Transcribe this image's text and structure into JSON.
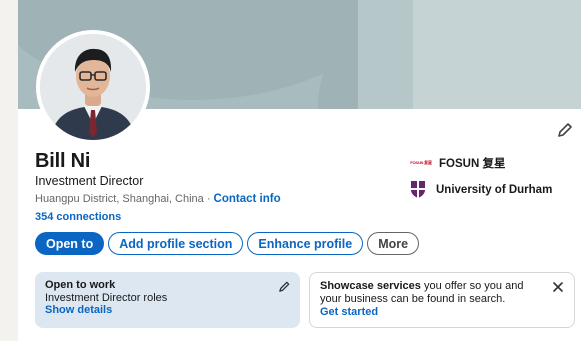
{
  "profile": {
    "name": "Bill Ni",
    "headline": "Investment Director",
    "location": "Huangpu District, Shanghai, China",
    "separator": " · ",
    "contact_label": "Contact info",
    "connections": "354 connections"
  },
  "experience": {
    "company": "FOSUN 复星",
    "company_logo_text": "FOSUN 复星",
    "school": "University of Durham"
  },
  "actions": {
    "open_to": "Open to",
    "add_section": "Add profile section",
    "enhance": "Enhance profile",
    "more": "More"
  },
  "open_to_work": {
    "title": "Open to work",
    "subtitle": "Investment Director roles",
    "link": "Show details"
  },
  "services": {
    "bold_text": "Showcase services",
    "text": " you offer so you and your business can be found in search.",
    "link": "Get started"
  },
  "colors": {
    "brand_blue": "#0a66c2",
    "banner": "#a8bcbf",
    "open_to_work_bg": "#dde7f1"
  },
  "icons": {
    "edit": "pencil-icon",
    "close": "close-icon"
  }
}
